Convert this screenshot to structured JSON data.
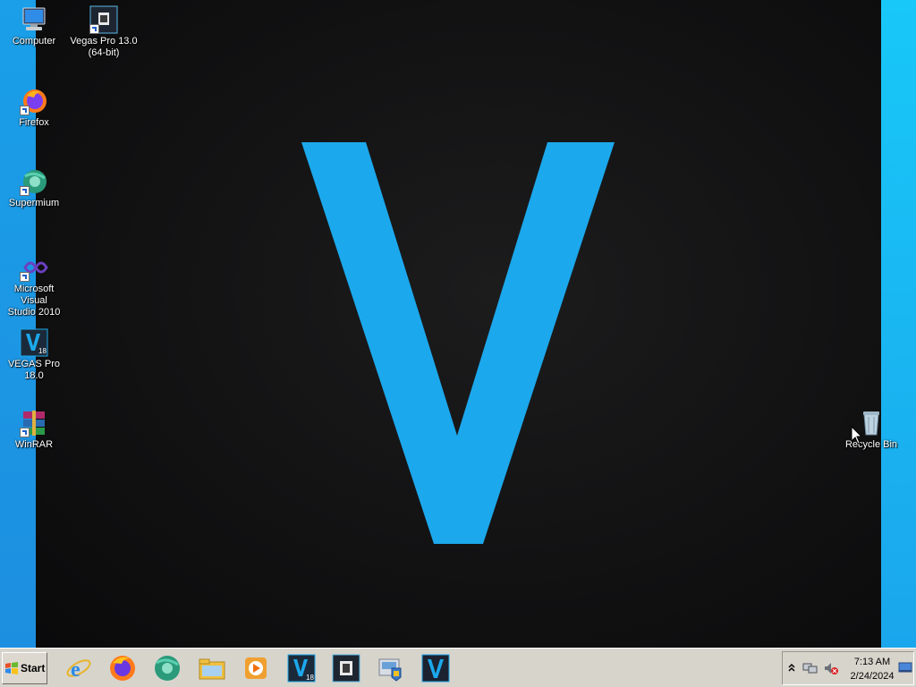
{
  "desktop": {
    "icons": [
      {
        "label": "Computer"
      },
      {
        "label": "Vegas Pro 13.0\n(64-bit)"
      },
      {
        "label": "Firefox"
      },
      {
        "label": "Supermium"
      },
      {
        "label": "Microsoft Visual\nStudio 2010"
      },
      {
        "label": "VEGAS Pro\n18.0"
      },
      {
        "label": "WinRAR"
      },
      {
        "label": "Recycle Bin"
      }
    ],
    "wallpaper_letter": "V",
    "accent_color": "#1ca8ec"
  },
  "taskbar": {
    "start_label": "Start",
    "pinned": [
      {
        "icon": "internet-explorer-icon"
      },
      {
        "icon": "firefox-icon"
      },
      {
        "icon": "supermium-icon"
      },
      {
        "icon": "file-explorer-icon"
      },
      {
        "icon": "media-player-icon"
      },
      {
        "icon": "vegas-pro-18-icon",
        "text": "V",
        "sub": "18"
      },
      {
        "icon": "vegas-pro-13-icon"
      },
      {
        "icon": "control-panel-icon"
      },
      {
        "icon": "vegas-icon",
        "text": "V"
      }
    ],
    "clock": {
      "time": "7:13 AM",
      "date": "2/24/2024"
    }
  }
}
